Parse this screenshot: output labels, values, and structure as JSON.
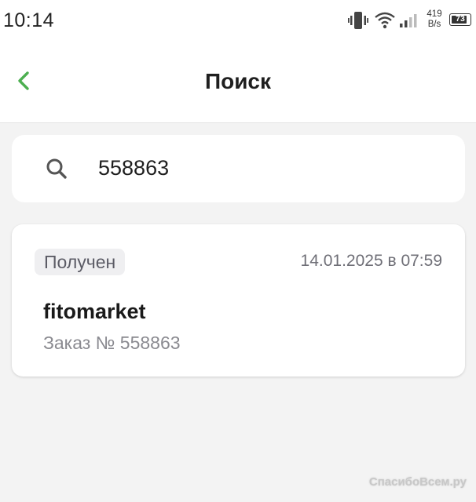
{
  "status_bar": {
    "time": "10:14",
    "net_speed_value": "419",
    "net_speed_unit": "B/s",
    "battery_level": "73"
  },
  "header": {
    "title": "Поиск",
    "back_icon": "chevron-left-icon",
    "accent_color": "#4caf50"
  },
  "search": {
    "icon": "search-icon",
    "value": "558863"
  },
  "results": [
    {
      "status": "Получен",
      "date": "14.01.2025 в 07:59",
      "shop": "fitomarket",
      "order_number": "Заказ № 558863"
    }
  ],
  "watermark": "СпасибоВсем.ру"
}
